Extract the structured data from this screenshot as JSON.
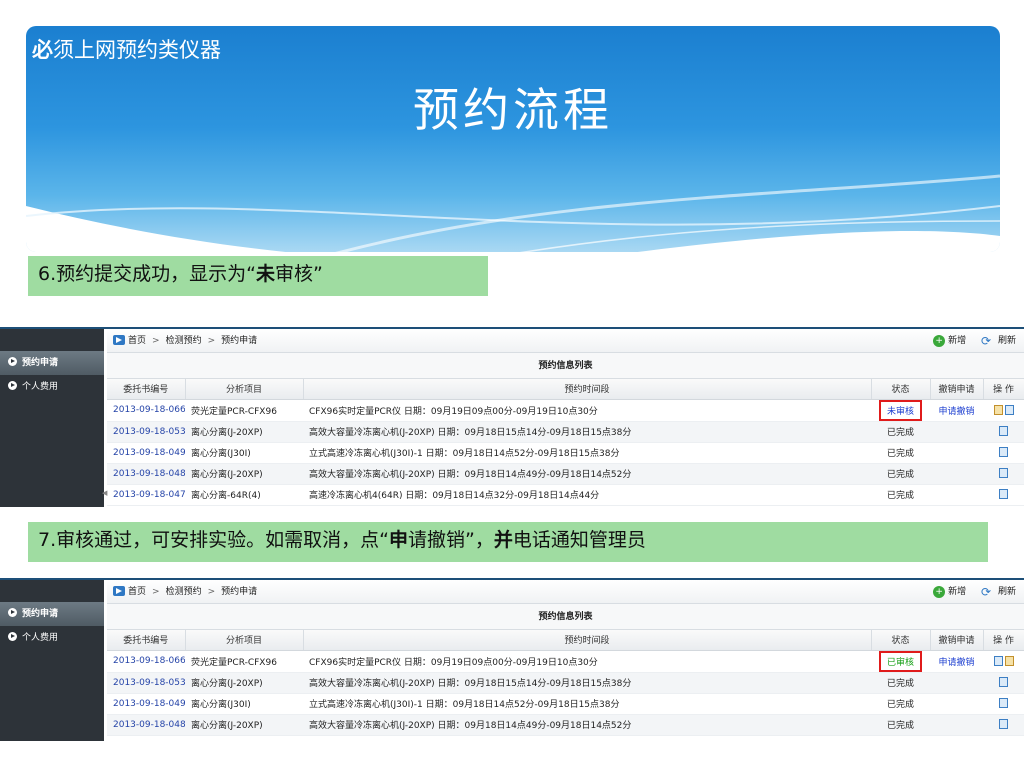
{
  "slide": {
    "subtitle_bold": "必",
    "subtitle_rest": "须上网预约类仪器",
    "title": "预约流程"
  },
  "step6": {
    "prefix": "6.预约提交成功，显示为“",
    "bold": "未",
    "suffix": "审核”"
  },
  "step7": {
    "prefix": "7.审核通过，可安排实验。如需取消，点“",
    "bold1": "申",
    "middle": "请撤销”，",
    "bold2": "并",
    "suffix": "电话通知管理员"
  },
  "app": {
    "sidebar": {
      "item1": "预约申请",
      "item2": "个人费用"
    },
    "breadcrumb": {
      "home": "首页",
      "sep": ">",
      "level2": "检测预约",
      "level3": "预约申请"
    },
    "actions": {
      "add": "新增",
      "refresh": "刷新"
    },
    "table_title": "预约信息列表",
    "columns": {
      "id": "委托书编号",
      "item": "分析项目",
      "time": "预约时间段",
      "status": "状态",
      "cancel": "撤销申请",
      "ops": "操 作"
    }
  },
  "table1": {
    "rows": [
      {
        "id": "2013-09-18-066",
        "item": "荧光定量PCR-CFX96",
        "time": "CFX96实时定量PCR仪 日期：09月19日09点00分-09月19日10点30分",
        "status": "未审核",
        "cancel": "申请撤销"
      },
      {
        "id": "2013-09-18-053",
        "item": "离心分离(J-20XP)",
        "time": "高效大容量冷冻离心机(J-20XP) 日期：09月18日15点14分-09月18日15点38分",
        "status": "已完成",
        "cancel": ""
      },
      {
        "id": "2013-09-18-049",
        "item": "离心分离(J30I)",
        "time": "立式高速冷冻离心机(J30I)-1 日期：09月18日14点52分-09月18日15点38分",
        "status": "已完成",
        "cancel": ""
      },
      {
        "id": "2013-09-18-048",
        "item": "离心分离(J-20XP)",
        "time": "高效大容量冷冻离心机(J-20XP) 日期：09月18日14点49分-09月18日14点52分",
        "status": "已完成",
        "cancel": ""
      },
      {
        "id": "2013-09-18-047",
        "item": "离心分离-64R(4)",
        "time": "高速冷冻离心机4(64R) 日期：09月18日14点32分-09月18日14点44分",
        "status": "已完成",
        "cancel": ""
      }
    ]
  },
  "table2": {
    "rows": [
      {
        "id": "2013-09-18-066",
        "item": "荧光定量PCR-CFX96",
        "time": "CFX96实时定量PCR仪 日期：09月19日09点00分-09月19日10点30分",
        "status": "已审核",
        "cancel": "申请撤销"
      },
      {
        "id": "2013-09-18-053",
        "item": "离心分离(J-20XP)",
        "time": "高效大容量冷冻离心机(J-20XP) 日期：09月18日15点14分-09月18日15点38分",
        "status": "已完成",
        "cancel": ""
      },
      {
        "id": "2013-09-18-049",
        "item": "离心分离(J30I)",
        "time": "立式高速冷冻离心机(J30I)-1 日期：09月18日14点52分-09月18日15点38分",
        "status": "已完成",
        "cancel": ""
      },
      {
        "id": "2013-09-18-048",
        "item": "离心分离(J-20XP)",
        "time": "高效大容量冷冻离心机(J-20XP) 日期：09月18日14点49分-09月18日14点52分",
        "status": "已完成",
        "cancel": ""
      }
    ]
  },
  "colors": {
    "banner": "#2d95df",
    "step_bg": "#9fdca1",
    "pending": "#1d3fd0",
    "approved": "#18a018",
    "highlight": "#e01b1b"
  }
}
